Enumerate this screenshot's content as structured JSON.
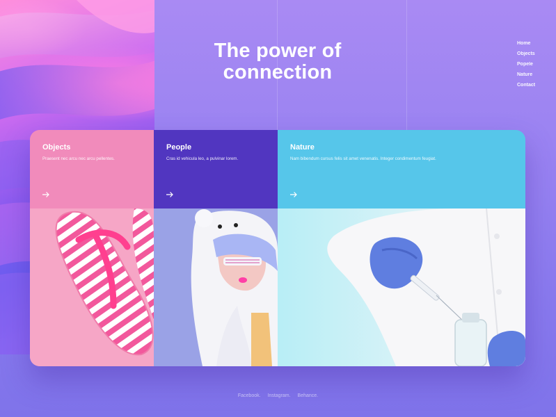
{
  "hero": {
    "title_line1": "The power of",
    "title_line2": "connection"
  },
  "nav": {
    "items": [
      {
        "label": "Home"
      },
      {
        "label": "Objects"
      },
      {
        "label": "Popele"
      },
      {
        "label": "Nature"
      },
      {
        "label": "Contact"
      }
    ]
  },
  "cards": [
    {
      "title": "Objects",
      "desc": "Praesent nec arcu nec arcu pellentes.",
      "arrow_icon": "arrow-right-icon",
      "image": "striped-flip-flops-photo",
      "color": "#f18bbb"
    },
    {
      "title": "People",
      "desc": "Cras id vehicula leo, a pulvinar lorem.",
      "arrow_icon": "arrow-right-icon",
      "image": "woman-in-bear-costume-photo",
      "color": "#5136c0"
    },
    {
      "title": "Nature",
      "desc": "Nam bibendum cursus felis sit amet venenatis. Integer condimentum feugiat.",
      "arrow_icon": "arrow-right-icon",
      "image": "lab-scientist-with-syringe-photo",
      "color": "#56c6ea"
    }
  ],
  "footer": {
    "links": [
      {
        "label": "Facebook."
      },
      {
        "label": "Instagram."
      },
      {
        "label": "Behance."
      }
    ]
  },
  "colors": {
    "bg_top": "#a98af3",
    "bg_bottom": "#7f73ea",
    "accent_pink": "#ff8fdc"
  }
}
